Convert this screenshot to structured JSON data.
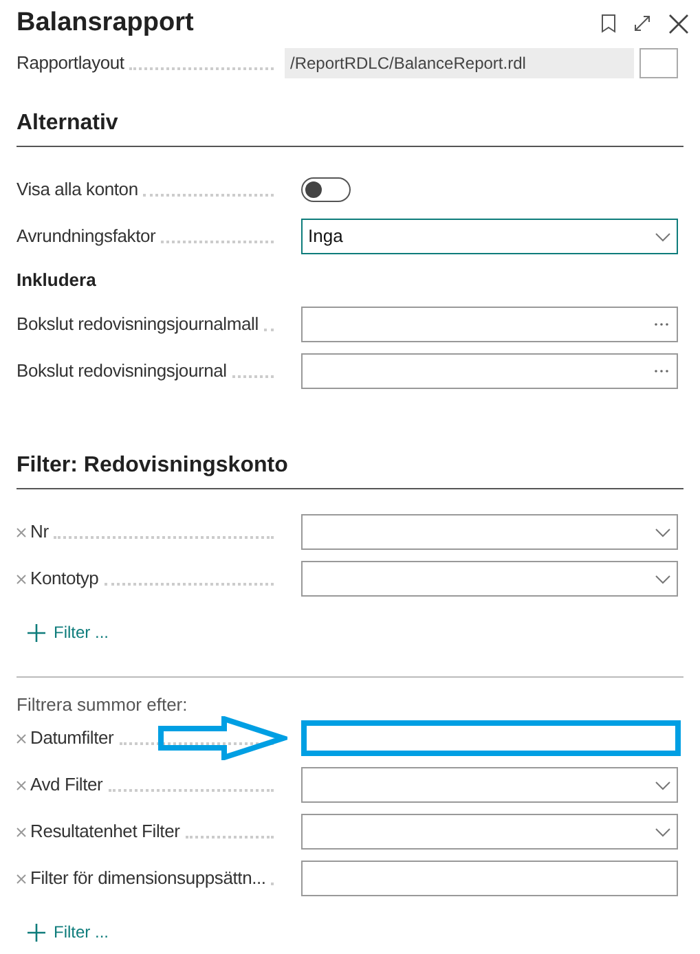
{
  "window": {
    "title": "Balansrapport"
  },
  "report_layout": {
    "label": "Rapportlayout",
    "value": "/ReportRDLC/BalanceReport.rdl"
  },
  "sections": [
    {
      "title": "Alternativ",
      "rows": [
        {
          "kind": "toggle",
          "label": "Visa alla konton",
          "on": false
        },
        {
          "kind": "dropdown",
          "label": "Avrundningsfaktor",
          "value": "Inga",
          "focused": true
        },
        {
          "kind": "subheading",
          "label": "Inkludera"
        },
        {
          "kind": "lookup",
          "label": "Bokslut redovisningsjournalmall"
        },
        {
          "kind": "lookup",
          "label": "Bokslut redovisningsjournal"
        }
      ]
    },
    {
      "title": "Filter: Redovisningskonto",
      "rows": [
        {
          "kind": "filter_dropdown",
          "label": "Nr"
        },
        {
          "kind": "filter_dropdown",
          "label": "Kontotyp"
        },
        {
          "kind": "add_filter",
          "label": "Filter ..."
        },
        {
          "kind": "caption",
          "label": "Filtrera summor efter:"
        },
        {
          "kind": "filter_text",
          "label": "Datumfilter",
          "highlighted": true
        },
        {
          "kind": "filter_dropdown",
          "label": "Avd Filter"
        },
        {
          "kind": "filter_dropdown",
          "label": "Resultatenhet Filter"
        },
        {
          "kind": "filter_text",
          "label": "Filter för dimensionsuppsättn..."
        },
        {
          "kind": "add_filter",
          "label": "Filter ..."
        }
      ]
    }
  ]
}
